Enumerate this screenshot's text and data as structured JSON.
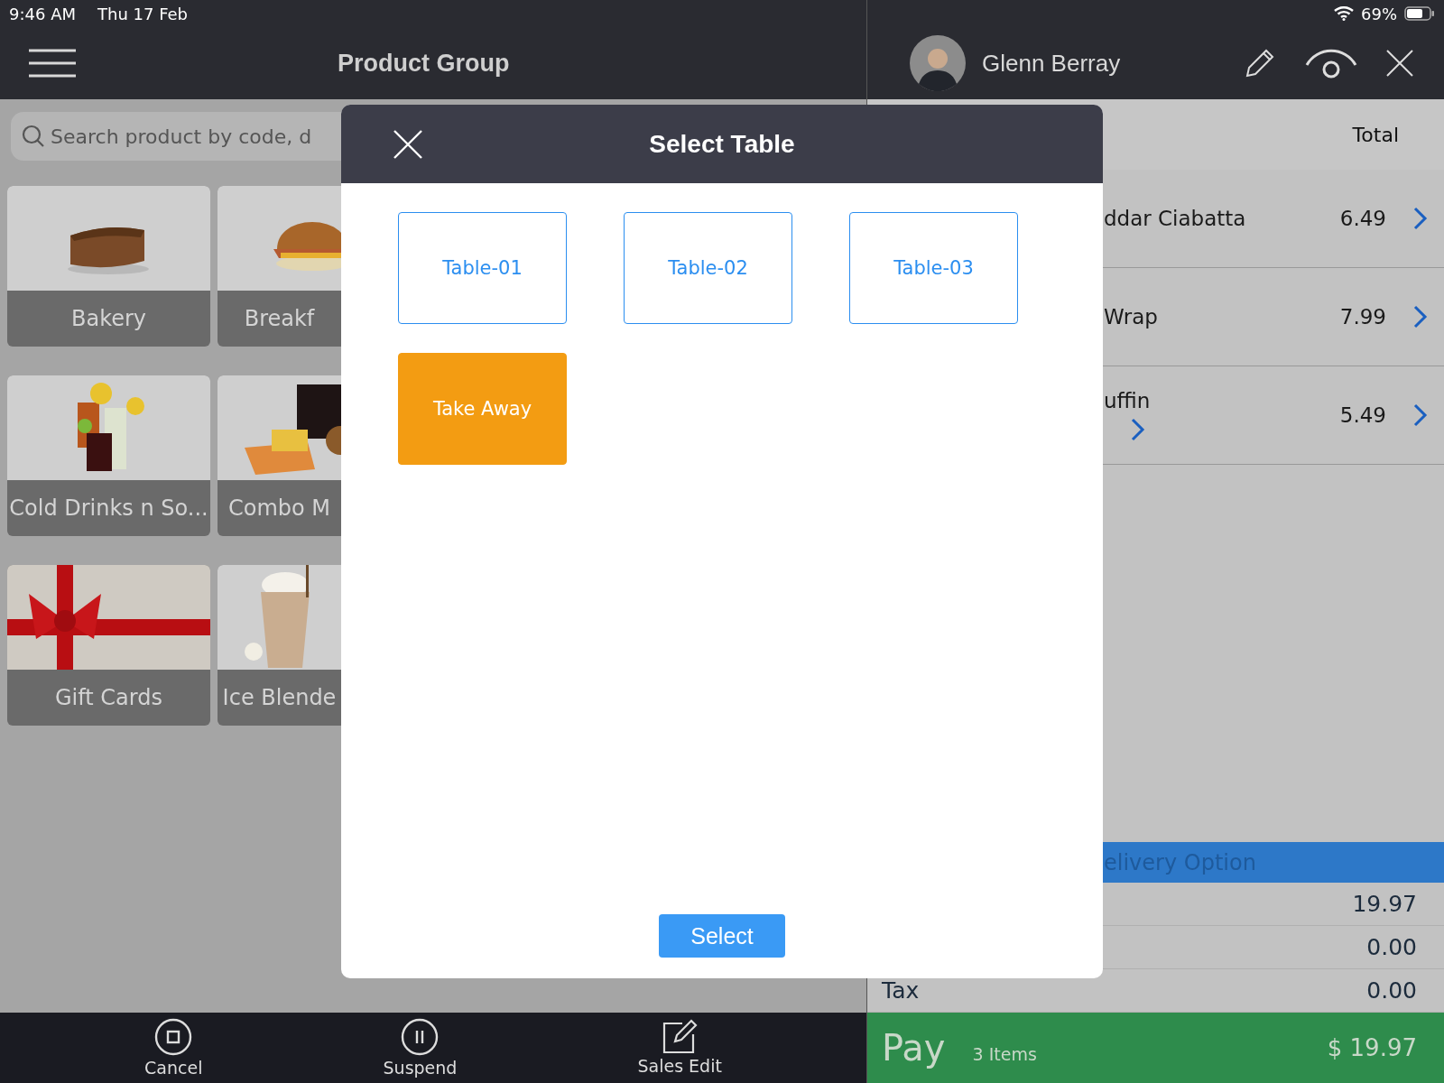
{
  "status_bar": {
    "time": "9:46 AM",
    "date": "Thu 17 Feb",
    "battery": "69%"
  },
  "left_header": {
    "title": "Product Group"
  },
  "search": {
    "placeholder": "Search product by code, d"
  },
  "product_groups": [
    {
      "label": "Bakery"
    },
    {
      "label": "Breakf"
    },
    {
      "label": "Cold Drinks n So..."
    },
    {
      "label": "Combo M"
    },
    {
      "label": "Gift Cards"
    },
    {
      "label": "Ice Blende"
    }
  ],
  "right_header": {
    "user": "Glenn Berray"
  },
  "order": {
    "total_header": "Total",
    "rows": [
      {
        "name": "ddar Ciabatta",
        "price": "6.49",
        "sub_chevron": false
      },
      {
        "name": "Wrap",
        "price": "7.99",
        "sub_chevron": false
      },
      {
        "name": "uffin",
        "price": "5.49",
        "sub_chevron": true
      }
    ],
    "delivery_option": "elivery Option",
    "summary": [
      {
        "value": "19.97"
      },
      {
        "value": "0.00"
      },
      {
        "label": "Tax",
        "value": "0.00"
      }
    ],
    "pay": {
      "label": "Pay",
      "items": "3 Items",
      "amount": "$ 19.97"
    }
  },
  "bottom_bar": [
    {
      "label": "Cancel",
      "kind": "cancel"
    },
    {
      "label": "Suspend",
      "kind": "suspend"
    },
    {
      "label": "Sales Edit",
      "kind": "edit"
    }
  ],
  "modal": {
    "title": "Select Table",
    "options": [
      {
        "label": "Table-01",
        "selected": false
      },
      {
        "label": "Table-02",
        "selected": false
      },
      {
        "label": "Table-03",
        "selected": false
      },
      {
        "label": "Take Away",
        "selected": true
      }
    ],
    "button": "Select"
  }
}
